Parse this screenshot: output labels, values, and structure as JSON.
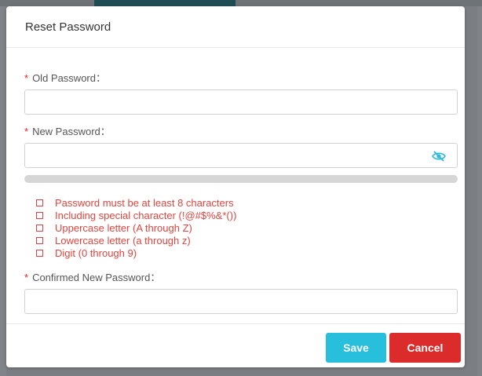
{
  "dialog": {
    "title": "Reset Password"
  },
  "fields": {
    "required_mark": "*",
    "old_password": {
      "label": "Old Password：",
      "value": ""
    },
    "new_password": {
      "label": "New Password：",
      "value": "",
      "toggle_icon": "eye-slash-icon"
    },
    "confirm_password": {
      "label": "Confirmed New Password：",
      "value": ""
    }
  },
  "strength": {
    "level": 0
  },
  "rules": [
    {
      "text": "Password must be at least 8 characters",
      "met": false
    },
    {
      "text": "Including special character (!@#$%&*())",
      "met": false
    },
    {
      "text": "Uppercase letter (A through Z)",
      "met": false
    },
    {
      "text": "Lowercase letter (a through z)",
      "met": false
    },
    {
      "text": "Digit (0 through 9)",
      "met": false
    }
  ],
  "buttons": {
    "save_label": "Save",
    "cancel_label": "Cancel"
  },
  "colors": {
    "required": "#e0262d",
    "rule_text": "#e0453f",
    "save": "#27bfdc",
    "cancel": "#dc2b2b",
    "eye_icon": "#2ab8d8"
  }
}
